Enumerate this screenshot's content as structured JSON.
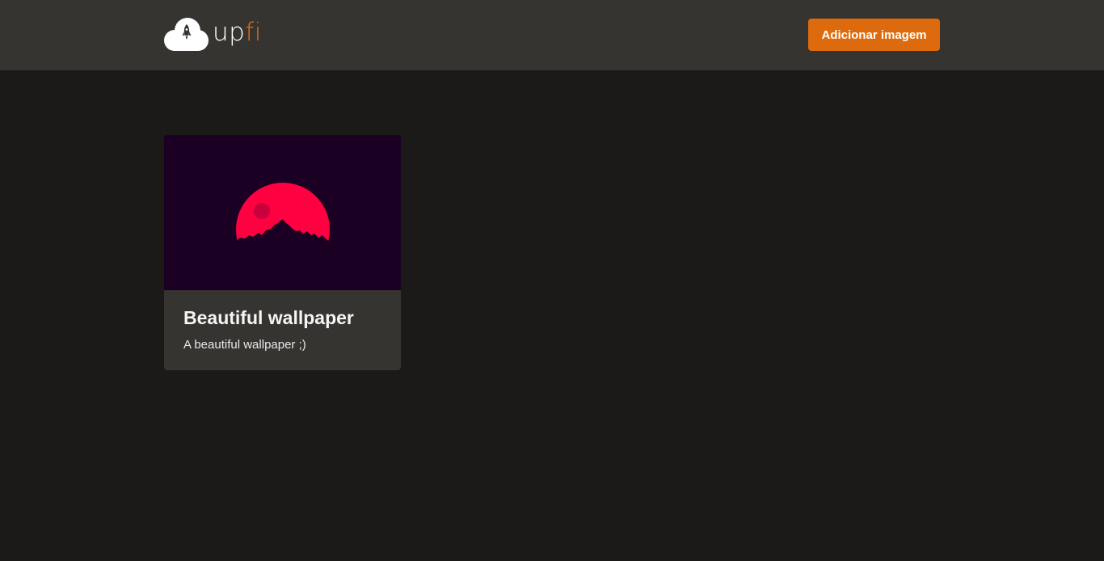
{
  "header": {
    "logo": {
      "text_part1": "up",
      "text_part2": "fi",
      "icon": "cloud-rocket-icon"
    },
    "add_button_label": "Adicionar imagem"
  },
  "gallery": {
    "cards": [
      {
        "image_alt": "Beautiful wallpaper",
        "title": "Beautiful wallpaper",
        "description": "A beautiful wallpaper ;)"
      }
    ]
  },
  "colors": {
    "background": "#1b1a18",
    "header": "#353431",
    "accent": "#dd6b0d",
    "card": "#353431",
    "wallpaper_bg": "#1c0024",
    "wallpaper_sun": "#ff0040"
  }
}
